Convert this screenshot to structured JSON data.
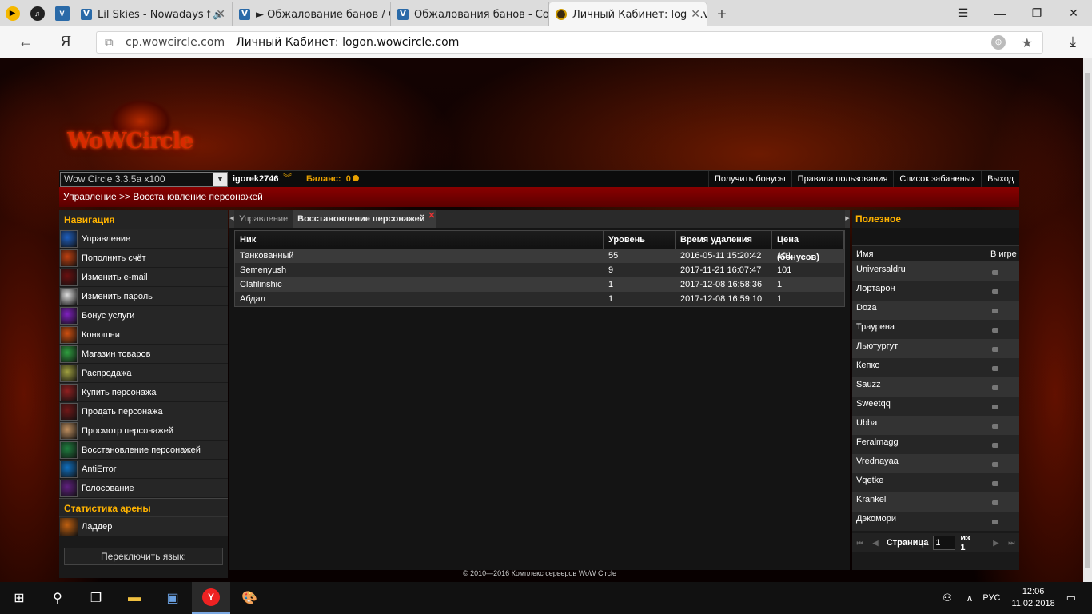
{
  "browser": {
    "tabs": [
      {
        "title": "Lil Skies - Nowadays f",
        "kind": "v"
      },
      {
        "title": "► Обжалование банов / Ф",
        "kind": "v"
      },
      {
        "title": "Обжалования банов - Созд",
        "kind": "v"
      },
      {
        "title": "Личный Кабинет: logon.v",
        "kind": "w"
      }
    ],
    "address_host": "cp.wowcircle.com",
    "address_title": "Личный Кабинет: logon.wowcircle.com",
    "yandex_logo": "Я"
  },
  "site": {
    "logo_text": "WoWCircle",
    "realm": "Wow Circle 3.3.5a x100",
    "username": "igorek2746",
    "balance_label": "Баланс:",
    "balance_value": "0",
    "top_links": [
      "Получить бонусы",
      "Правила пользования",
      "Список забаненых",
      "Выход"
    ],
    "breadcrumb": "Управление >>  Восстановление персонажей",
    "nav_title": "Навигация",
    "nav_items": [
      {
        "label": "Управление",
        "color": "#1f5fbf"
      },
      {
        "label": "Пополнить счёт",
        "color": "#c04010"
      },
      {
        "label": "Изменить e-mail",
        "color": "#6a1010"
      },
      {
        "label": "Изменить пароль",
        "color": "#ddd"
      },
      {
        "label": "Бонус услуги",
        "color": "#8020c0"
      },
      {
        "label": "Конюшни",
        "color": "#d05010"
      },
      {
        "label": "Магазин товаров",
        "color": "#30a040"
      },
      {
        "label": "Распродажа",
        "color": "#a0a040"
      },
      {
        "label": "Купить персонажа",
        "color": "#902020"
      },
      {
        "label": "Продать персонажа",
        "color": "#701818"
      },
      {
        "label": "Просмотр персонажей",
        "color": "#c09060"
      },
      {
        "label": "Восстановление персонажей",
        "color": "#208040"
      },
      {
        "label": "AntiError",
        "color": "#1070c0"
      },
      {
        "label": "Голосование",
        "color": "#602080"
      }
    ],
    "arena_title": "Статистика арены",
    "arena_items": [
      {
        "label": "Ладдер",
        "color": "#c06010"
      }
    ],
    "lang_button": "Переключить язык:",
    "content_tabs": [
      "Управление",
      "Восстановление персонажей"
    ],
    "table": {
      "headers": [
        "Ник",
        "Уровень",
        "Время удаления",
        "Цена (бонусов)"
      ],
      "rows": [
        [
          "Танкованный",
          "55",
          "2016-05-11 15:20:42",
          "101"
        ],
        [
          "Semenyush",
          "9",
          "2017-11-21 16:07:47",
          "101"
        ],
        [
          "Clafilinshic",
          "1",
          "2017-12-08 16:58:36",
          "1"
        ],
        [
          "Абдал",
          "1",
          "2017-12-08 16:59:10",
          "1"
        ]
      ]
    },
    "footer": "© 2010—2016 Комплекс серверов WoW Circle",
    "useful_title": "Полезное",
    "online": {
      "headers": [
        "Имя",
        "В игре"
      ],
      "players": [
        "Universaldru",
        "Лортарон",
        "Doza",
        "Траурена",
        "Льютургут",
        "Кепко",
        "Sauzz",
        "Sweetqq",
        "Ubba",
        "Feralmagg",
        "Vrednayaa",
        "Vqetke",
        "Krankel",
        "Дэкомори"
      ],
      "page_label": "Страница",
      "page": "1",
      "of_label": "из 1"
    }
  },
  "taskbar": {
    "lang": "РУС",
    "time": "12:06",
    "date": "11.02.2018"
  }
}
